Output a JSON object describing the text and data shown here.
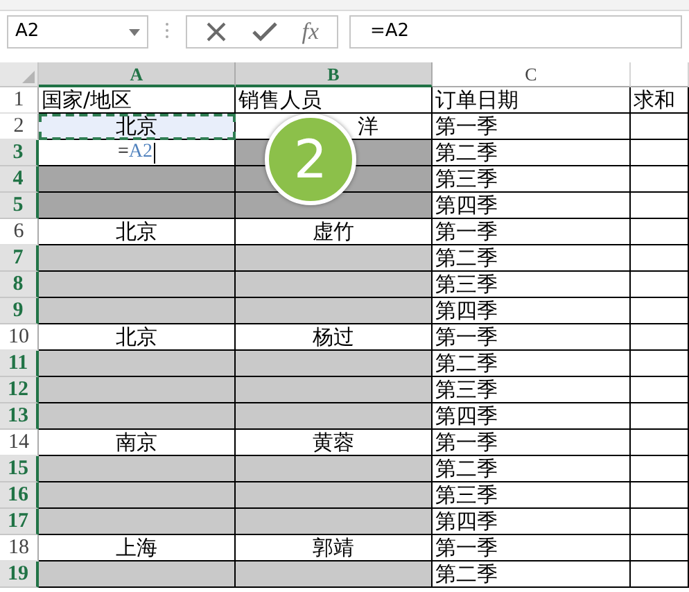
{
  "formula_bar": {
    "name_box": "A2",
    "fx": "fx",
    "formula": "=A2"
  },
  "columns": [
    {
      "label": "A",
      "selected": true
    },
    {
      "label": "B",
      "selected": true
    },
    {
      "label": "C",
      "selected": false
    },
    {
      "selected": false
    }
  ],
  "rows": [
    {
      "number": "1",
      "selected": false,
      "cells": [
        {
          "kind": "left",
          "text": "国家/地区"
        },
        {
          "kind": "left",
          "text": "销售人员"
        },
        {
          "kind": "left",
          "text": "订单日期"
        },
        {
          "kind": "left",
          "text": "求和"
        }
      ]
    },
    {
      "number": "2",
      "selected": false,
      "cells": [
        {
          "kind": "copy_source",
          "text": "北京"
        },
        {
          "kind": "partial",
          "text": "洋"
        },
        {
          "kind": "left",
          "text": "第一季"
        },
        {
          "kind": "blank"
        }
      ]
    },
    {
      "number": "3",
      "selected": true,
      "cells": [
        {
          "kind": "edit",
          "prefix": "=",
          "reference": "A2"
        },
        {
          "kind": "dark"
        },
        {
          "kind": "left",
          "text": "第二季"
        },
        {
          "kind": "blank"
        }
      ]
    },
    {
      "number": "4",
      "selected": true,
      "cells": [
        {
          "kind": "dark"
        },
        {
          "kind": "dark"
        },
        {
          "kind": "left",
          "text": "第三季"
        },
        {
          "kind": "blank"
        }
      ]
    },
    {
      "number": "5",
      "selected": true,
      "cells": [
        {
          "kind": "dark"
        },
        {
          "kind": "dark"
        },
        {
          "kind": "left",
          "text": "第四季"
        },
        {
          "kind": "blank"
        }
      ]
    },
    {
      "number": "6",
      "selected": false,
      "cells": [
        {
          "kind": "center",
          "text": "北京"
        },
        {
          "kind": "center",
          "text": "虚竹"
        },
        {
          "kind": "left",
          "text": "第一季"
        },
        {
          "kind": "blank"
        }
      ]
    },
    {
      "number": "7",
      "selected": true,
      "cells": [
        {
          "kind": "light"
        },
        {
          "kind": "light"
        },
        {
          "kind": "left",
          "text": "第二季"
        },
        {
          "kind": "blank"
        }
      ]
    },
    {
      "number": "8",
      "selected": true,
      "cells": [
        {
          "kind": "light"
        },
        {
          "kind": "light"
        },
        {
          "kind": "left",
          "text": "第三季"
        },
        {
          "kind": "blank"
        }
      ]
    },
    {
      "number": "9",
      "selected": true,
      "cells": [
        {
          "kind": "light"
        },
        {
          "kind": "light"
        },
        {
          "kind": "left",
          "text": "第四季"
        },
        {
          "kind": "blank"
        }
      ]
    },
    {
      "number": "10",
      "selected": false,
      "cells": [
        {
          "kind": "center",
          "text": "北京"
        },
        {
          "kind": "center",
          "text": "杨过"
        },
        {
          "kind": "left",
          "text": "第一季"
        },
        {
          "kind": "blank"
        }
      ]
    },
    {
      "number": "11",
      "selected": true,
      "cells": [
        {
          "kind": "light"
        },
        {
          "kind": "light"
        },
        {
          "kind": "left",
          "text": "第二季"
        },
        {
          "kind": "blank"
        }
      ]
    },
    {
      "number": "12",
      "selected": true,
      "cells": [
        {
          "kind": "light"
        },
        {
          "kind": "light"
        },
        {
          "kind": "left",
          "text": "第三季"
        },
        {
          "kind": "blank"
        }
      ]
    },
    {
      "number": "13",
      "selected": true,
      "cells": [
        {
          "kind": "light"
        },
        {
          "kind": "light"
        },
        {
          "kind": "left",
          "text": "第四季"
        },
        {
          "kind": "blank"
        }
      ]
    },
    {
      "number": "14",
      "selected": false,
      "cells": [
        {
          "kind": "center",
          "text": "南京"
        },
        {
          "kind": "center",
          "text": "黄蓉"
        },
        {
          "kind": "left",
          "text": "第一季"
        },
        {
          "kind": "blank"
        }
      ]
    },
    {
      "number": "15",
      "selected": true,
      "cells": [
        {
          "kind": "light"
        },
        {
          "kind": "light"
        },
        {
          "kind": "left",
          "text": "第二季"
        },
        {
          "kind": "blank"
        }
      ]
    },
    {
      "number": "16",
      "selected": true,
      "cells": [
        {
          "kind": "light"
        },
        {
          "kind": "light"
        },
        {
          "kind": "left",
          "text": "第三季"
        },
        {
          "kind": "blank"
        }
      ]
    },
    {
      "number": "17",
      "selected": true,
      "cells": [
        {
          "kind": "light"
        },
        {
          "kind": "light"
        },
        {
          "kind": "left",
          "text": "第四季"
        },
        {
          "kind": "blank"
        }
      ]
    },
    {
      "number": "18",
      "selected": false,
      "cells": [
        {
          "kind": "center",
          "text": "上海"
        },
        {
          "kind": "center",
          "text": "郭靖"
        },
        {
          "kind": "left",
          "text": "第一季"
        },
        {
          "kind": "blank"
        }
      ]
    },
    {
      "number": "19",
      "selected": true,
      "cells": [
        {
          "kind": "light"
        },
        {
          "kind": "light"
        },
        {
          "kind": "left",
          "text": "第二季"
        },
        {
          "kind": "blank"
        }
      ]
    }
  ],
  "step_badge": {
    "text": "2"
  }
}
